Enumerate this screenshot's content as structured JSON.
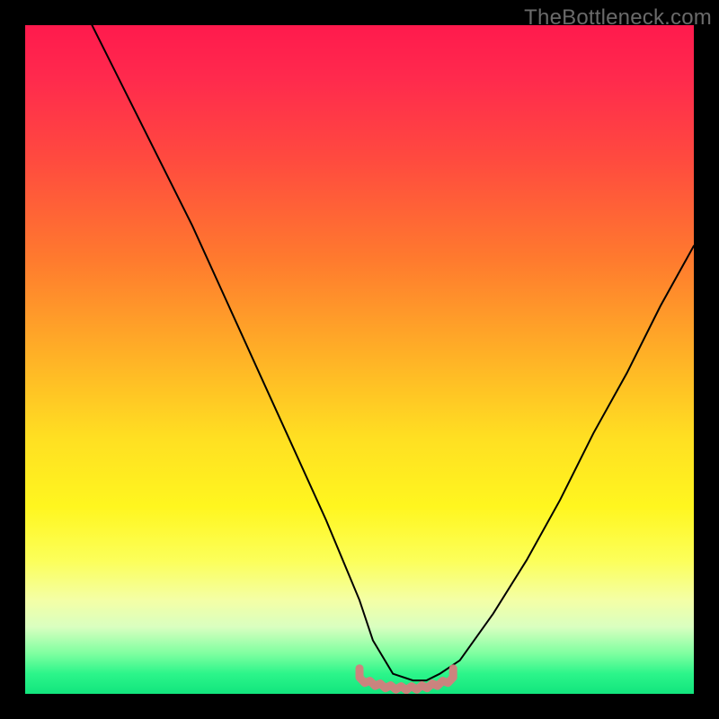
{
  "watermark": "TheBottleneck.com",
  "colors": {
    "background": "#000000",
    "curve": "#000000",
    "band": "#d47d7d",
    "gradient_stops": [
      "#ff1a4d",
      "#ff4a3f",
      "#ff7a2e",
      "#ffb326",
      "#ffe022",
      "#fff61f",
      "#fcff59",
      "#f4ffa6",
      "#d9ffc0",
      "#7effa0",
      "#2cf58a",
      "#12e57d"
    ]
  },
  "chart_data": {
    "type": "line",
    "title": "",
    "xlabel": "",
    "ylabel": "",
    "xlim": [
      0,
      100
    ],
    "ylim": [
      0,
      100
    ],
    "series": [
      {
        "name": "bottleneck-curve",
        "x": [
          10,
          15,
          20,
          25,
          30,
          35,
          40,
          45,
          50,
          52,
          55,
          58,
          60,
          62,
          65,
          70,
          75,
          80,
          85,
          90,
          95,
          100
        ],
        "values": [
          100,
          90,
          80,
          70,
          59,
          48,
          37,
          26,
          14,
          8,
          3,
          2,
          2,
          3,
          5,
          12,
          20,
          29,
          39,
          48,
          58,
          67
        ]
      }
    ],
    "optimal_band": {
      "name": "optimal-range",
      "x_start": 50,
      "x_end": 64,
      "y_approx": 3
    },
    "description": "V-shaped bottleneck curve over gradient background; left branch steeper than right; pink rough band marks near-zero minimum region."
  }
}
